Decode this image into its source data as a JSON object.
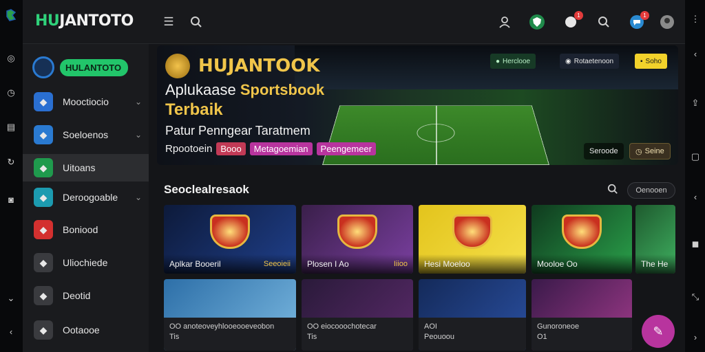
{
  "app": {
    "logo_hu": "HU",
    "logo_rest": "JANTOTO"
  },
  "header": {
    "menu_icon": "menu-icon",
    "search_icon": "search-icon",
    "user_icon": "user-icon",
    "shield_icon": "shield-icon",
    "chat_badge": "1",
    "chat_icon": "chat-icon",
    "search2_icon": "search-icon",
    "notify_badge": "1",
    "notify_icon": "message-icon",
    "avatar_icon": "avatar-icon"
  },
  "sidebar": {
    "brand": "HULANTOTO",
    "items": [
      {
        "label": "Mooctiocio",
        "icon": "trophy-icon",
        "chevron": true,
        "color": "#2a6fd1"
      },
      {
        "label": "Soeloenos",
        "icon": "grid-icon",
        "chevron": true,
        "color": "#2a7ad1"
      },
      {
        "label": "Uitoans",
        "icon": "money-icon",
        "chevron": false,
        "color": "#1f9a4d"
      },
      {
        "label": "Deroogoable",
        "icon": "tool-icon",
        "chevron": true,
        "color": "#1c9bb0"
      },
      {
        "label": "Boniood",
        "icon": "badge-icon",
        "chevron": false,
        "color": "#d3302f"
      },
      {
        "label": "Uliochiede",
        "icon": "ball-icon",
        "chevron": false,
        "color": "#3a3b3f"
      },
      {
        "label": "Deotid",
        "icon": "football-icon",
        "chevron": false,
        "color": "#3a3b3f"
      },
      {
        "label": "Ootaooe",
        "icon": "doc-icon",
        "chevron": false,
        "color": "#3a3b3f"
      }
    ]
  },
  "hero": {
    "title": "HUJANTOOK",
    "line1_a": "Aplukaase ",
    "line1_b": "Sportsbook",
    "line2": "Terbaik",
    "line3": "Patur Penngear Taratmem",
    "tag_lead": "Rpootoein",
    "tags": [
      {
        "label": "Booo",
        "color": "#c23a56"
      },
      {
        "label": "Metagoemian",
        "color": "#b8349e"
      },
      {
        "label": "Peengemeer",
        "color": "#b8349e"
      }
    ],
    "chips": [
      {
        "label": "Herclooe",
        "bg": "#173a26",
        "fg": "#b8f0c6"
      },
      {
        "label": "Rotaetenoon",
        "bg": "#1b2230",
        "fg": "#e8e8e8"
      },
      {
        "label": "Soho",
        "bg": "#f2d22b",
        "fg": "#1a1a1a"
      }
    ],
    "btn_left": "Seroode",
    "btn_right": "Seine"
  },
  "section": {
    "title": "Seoclealresaok",
    "button": "Oenooen"
  },
  "cards_row1": [
    {
      "title": "Aplkar Booeril",
      "sub": "Seeoieii",
      "bg": "linear-gradient(135deg,#0d1a3a,#1f3f8a)"
    },
    {
      "title": "Plosen I Ao",
      "sub": "Iiioo",
      "bg": "linear-gradient(135deg,#3a1f4a,#7a3fa0)"
    },
    {
      "title": "Hesi Moeloo",
      "sub": "",
      "bg": "linear-gradient(135deg,#e3c41c,#f5e04a)"
    },
    {
      "title": "Mooloe Oo",
      "sub": "",
      "bg": "linear-gradient(135deg,#0f3a1e,#2aa04a)"
    },
    {
      "title": "The He",
      "sub": "",
      "bg": "linear-gradient(135deg,#1e5a2e,#3fb060)"
    }
  ],
  "cards_row2": [
    {
      "title": "OO anoteoveyhlooeooeveobon",
      "sub": "Tis",
      "bg": "linear-gradient(135deg,#2d6fa8,#7ab8e0)"
    },
    {
      "title": "OO eiocooochotecar",
      "sub": "Tis",
      "bg": "linear-gradient(135deg,#2a1a3a,#5a2a6a)"
    },
    {
      "title": "AOI",
      "sub": "Peouoou",
      "bg": "linear-gradient(135deg,#142a5a,#2a4fa0)"
    },
    {
      "title": "Gunoroneoe",
      "sub": "O1",
      "bg": "linear-gradient(135deg,#3a1a4a,#a03a8a)"
    }
  ]
}
